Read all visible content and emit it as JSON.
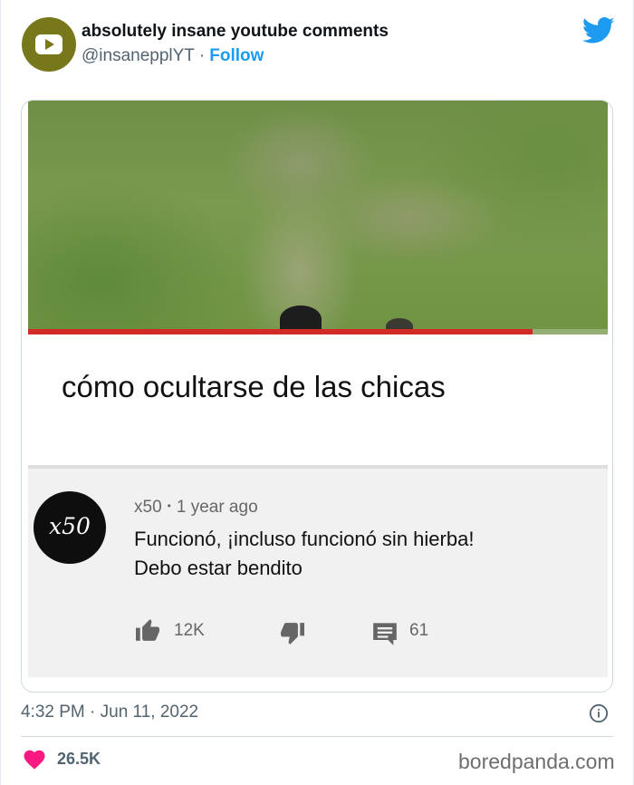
{
  "tweet": {
    "author_name": "absolutely insane youtube comments",
    "handle": "@insanepplYT",
    "separator": "·",
    "follow_label": "Follow",
    "avatar_icon": "youtube-logo-icon",
    "platform_icon": "twitter-bird-icon",
    "accent_color": "#1d9bf0"
  },
  "media": {
    "video_title": "cómo ocultarse de las chicas",
    "progress": 0.87,
    "progress_color": "#d22b25",
    "comment": {
      "avatar_text": "x50",
      "author": "x50",
      "time_ago": "1 year ago",
      "text_line_1": "Funcionó, ¡incluso funcionó sin hierba!",
      "text_line_2": "Debo estar bendito",
      "likes": "12K",
      "replies": "61",
      "icons": [
        "thumbs-up-icon",
        "thumbs-down-icon",
        "reply-icon"
      ]
    }
  },
  "footer": {
    "timestamp": "4:32 PM · Jun 11, 2022",
    "like_count": "26.5K",
    "heart_color": "#f91880",
    "watermark": "boredpanda.com"
  }
}
